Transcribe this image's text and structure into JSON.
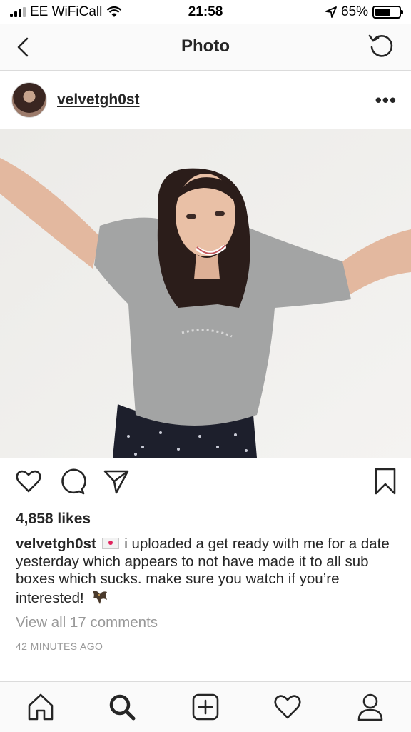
{
  "status_bar": {
    "carrier": "EE WiFiCall",
    "time": "21:58",
    "battery": "65%",
    "battery_level": 0.65
  },
  "nav": {
    "title": "Photo"
  },
  "post": {
    "username": "velvetgh0st",
    "likes": "4,858 likes",
    "caption_user": "velvetgh0st",
    "caption_text": "i uploaded a get ready with me for a date yesterday which appears to not have made it to all sub boxes which sucks. make sure you watch if you’re interested!",
    "view_comments": "View all 17 comments",
    "time_ago": "42 MINUTES AGO"
  },
  "icons": {
    "back": "chevron-left-icon",
    "refresh": "refresh-icon",
    "more": "more-options-icon",
    "like": "heart-icon",
    "comment": "comment-icon",
    "share": "send-icon",
    "save": "bookmark-icon",
    "tabs": [
      "home-icon",
      "search-icon",
      "add-post-icon",
      "activity-heart-icon",
      "profile-icon"
    ]
  },
  "colors": {
    "text": "#262626",
    "muted": "#999999",
    "divider": "#dbdbdb"
  }
}
